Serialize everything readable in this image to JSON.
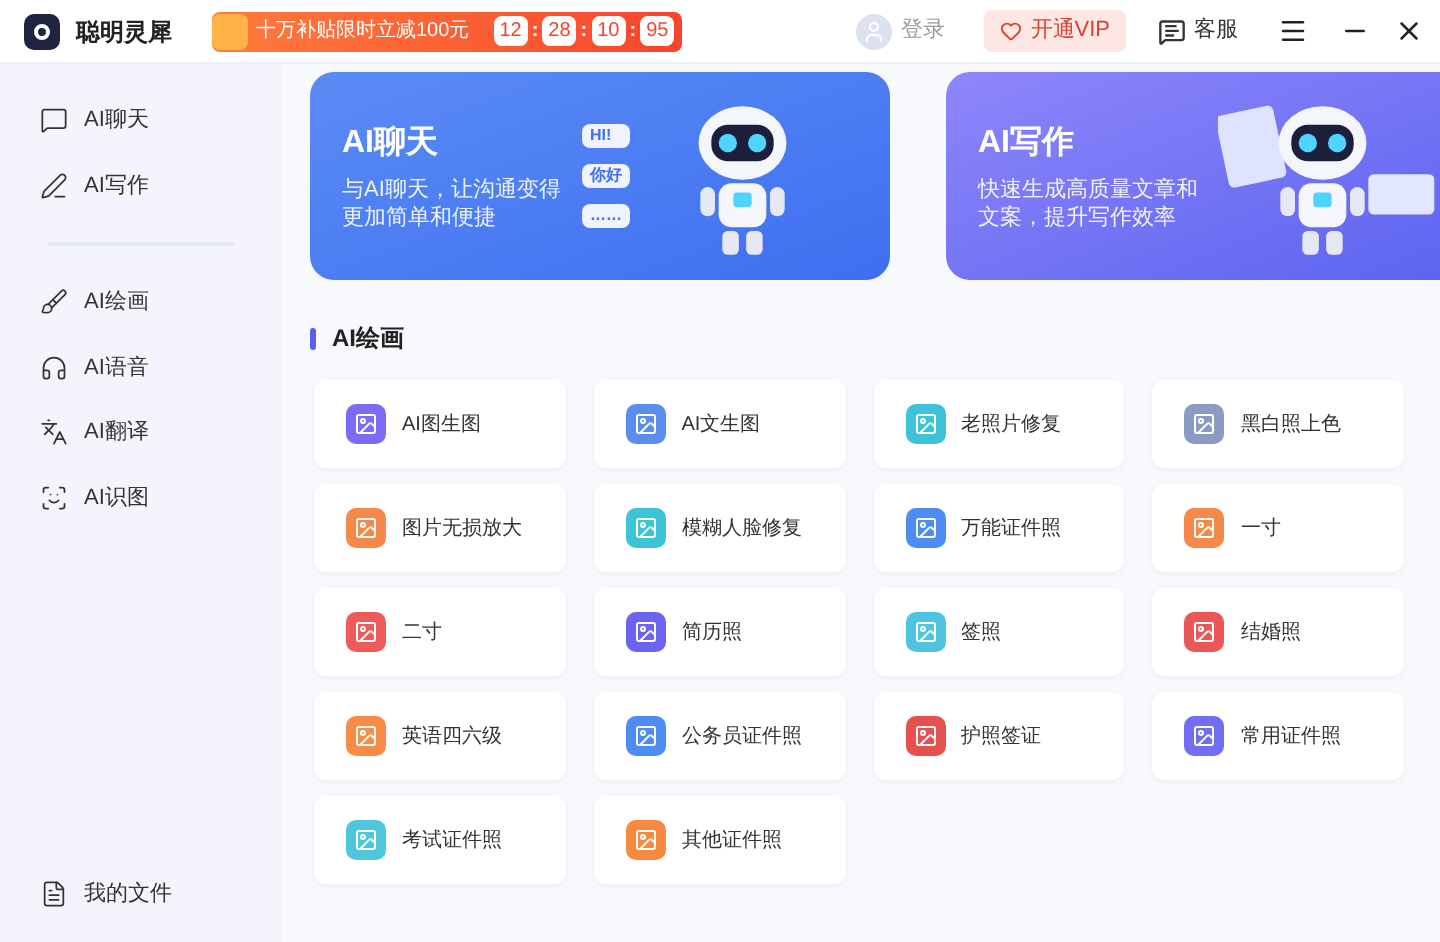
{
  "app": {
    "name": "聪明灵犀"
  },
  "promo": {
    "text": "十万补贴限时立减100元",
    "countdown": [
      "12",
      "28",
      "10",
      "95"
    ],
    "separator": ":"
  },
  "header": {
    "login": "登录",
    "vip": "开通VIP",
    "service": "客服"
  },
  "sidebar": {
    "groups": [
      [
        {
          "label": "AI聊天",
          "kind": "chat"
        },
        {
          "label": "AI写作",
          "kind": "pen"
        }
      ],
      [
        {
          "label": "AI绘画",
          "kind": "brush"
        },
        {
          "label": "AI语音",
          "kind": "headset"
        },
        {
          "label": "AI翻译",
          "kind": "translate"
        },
        {
          "label": "AI识图",
          "kind": "scan"
        }
      ]
    ],
    "footer": {
      "label": "我的文件",
      "kind": "file"
    }
  },
  "banners": [
    {
      "title": "AI聊天",
      "desc": "与AI聊天，让沟通变得更加简单和便捷",
      "kind": "chat",
      "bubbles": [
        "HI!",
        "你好",
        "……"
      ]
    },
    {
      "title": "AI写作",
      "desc": "快速生成高质量文章和文案，提升写作效率",
      "kind": "write"
    }
  ],
  "section": {
    "title": "AI绘画",
    "items": [
      {
        "label": "AI图生图",
        "color": "#7b6cf6"
      },
      {
        "label": "AI文生图",
        "color": "#5b8def"
      },
      {
        "label": "老照片修复",
        "color": "#3cc3d8"
      },
      {
        "label": "黑白照上色",
        "color": "#8c9bc4"
      },
      {
        "label": "图片无损放大",
        "color": "#f5894a"
      },
      {
        "label": "模糊人脸修复",
        "color": "#3cc3d8"
      },
      {
        "label": "万能证件照",
        "color": "#4d8cf2"
      },
      {
        "label": "一寸",
        "color": "#f5894a"
      },
      {
        "label": "二寸",
        "color": "#ef5a5a"
      },
      {
        "label": "简历照",
        "color": "#6c63f0"
      },
      {
        "label": "签照",
        "color": "#4fc4e0"
      },
      {
        "label": "结婚照",
        "color": "#e95757"
      },
      {
        "label": "英语四六级",
        "color": "#f98b44"
      },
      {
        "label": "公务员证件照",
        "color": "#4d8cf2"
      },
      {
        "label": "护照签证",
        "color": "#e84f4f"
      },
      {
        "label": "常用证件照",
        "color": "#6f6ef5"
      },
      {
        "label": "考试证件照",
        "color": "#4ec6dc"
      },
      {
        "label": "其他证件照",
        "color": "#f78a3e"
      }
    ]
  }
}
